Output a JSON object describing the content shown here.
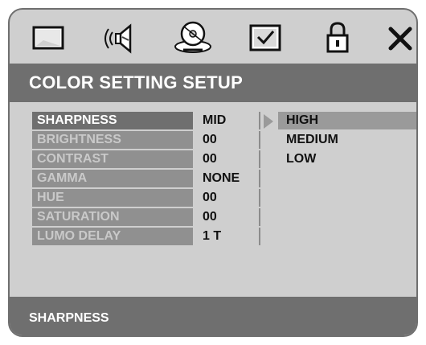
{
  "tabs": [
    {
      "icon": "monitor-icon"
    },
    {
      "icon": "speaker-icon"
    },
    {
      "icon": "disc-icon"
    },
    {
      "icon": "checkbox-icon"
    },
    {
      "icon": "lock-icon"
    },
    {
      "icon": "close-icon"
    }
  ],
  "title": "COLOR SETTING SETUP",
  "menu": [
    {
      "label": "SHARPNESS",
      "value": "MID",
      "selected": true
    },
    {
      "label": "BRIGHTNESS",
      "value": "00"
    },
    {
      "label": "CONTRAST",
      "value": "00"
    },
    {
      "label": "GAMMA",
      "value": "NONE"
    },
    {
      "label": "HUE",
      "value": "00"
    },
    {
      "label": "SATURATION",
      "value": "00"
    },
    {
      "label": "LUMO DELAY",
      "value": "1 T"
    }
  ],
  "options": [
    {
      "label": "HIGH",
      "selected": true
    },
    {
      "label": "MEDIUM"
    },
    {
      "label": "LOW"
    }
  ],
  "footer": "SHARPNESS",
  "colors": {
    "panel": "#cfcfcf",
    "bar": "#6f6f6f",
    "dim_label": "#c9c9c9",
    "highlight": "#9a9a9a"
  }
}
